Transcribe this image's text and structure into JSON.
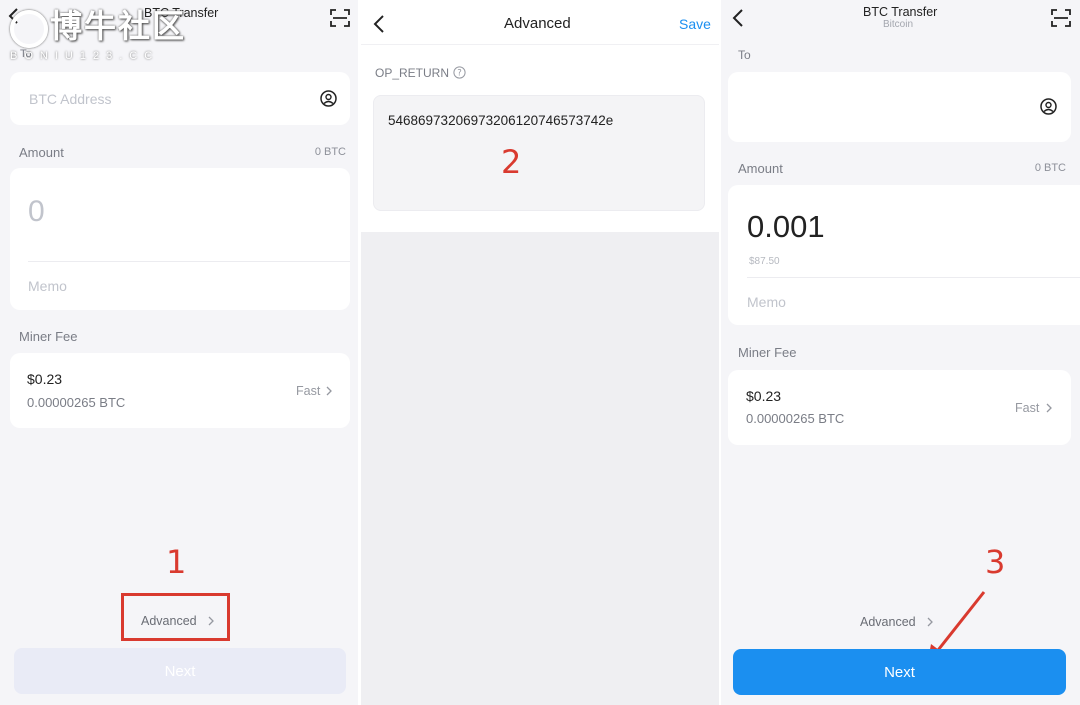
{
  "watermark": {
    "title": "博牛社区",
    "subtitle": "BONIU123.CC"
  },
  "panel1": {
    "header_title": "BTC Transfer",
    "to_label": "To",
    "address_placeholder": "BTC Address",
    "amount_label": "Amount",
    "balance": "0 BTC",
    "amount_placeholder": "0",
    "memo_placeholder": "Memo",
    "miner_fee_label": "Miner Fee",
    "fee_usd": "$0.23",
    "fee_btc": "0.00000265 BTC",
    "fee_speed": "Fast",
    "advanced_label": "Advanced",
    "next_label": "Next",
    "step_number": "1"
  },
  "panel2": {
    "header_title": "Advanced",
    "save_label": "Save",
    "op_return_label": "OP_RETURN",
    "op_return_value": "5468697320697320612074657374​2e",
    "step_number": "2"
  },
  "panel3": {
    "header_title": "BTC Transfer",
    "header_subtitle": "Bitcoin",
    "to_label": "To",
    "amount_label": "Amount",
    "balance": "0 BTC",
    "amount_value": "0.001",
    "amount_fiat": "$87.50",
    "memo_placeholder": "Memo",
    "miner_fee_label": "Miner Fee",
    "fee_usd": "$0.23",
    "fee_btc": "0.00000265 BTC",
    "fee_speed": "Fast",
    "advanced_label": "Advanced",
    "next_label": "Next",
    "step_number": "3"
  },
  "colors": {
    "accent": "#1b8ff0",
    "annotation_red": "#d93a2f",
    "page_background": "#f5f5f8"
  }
}
